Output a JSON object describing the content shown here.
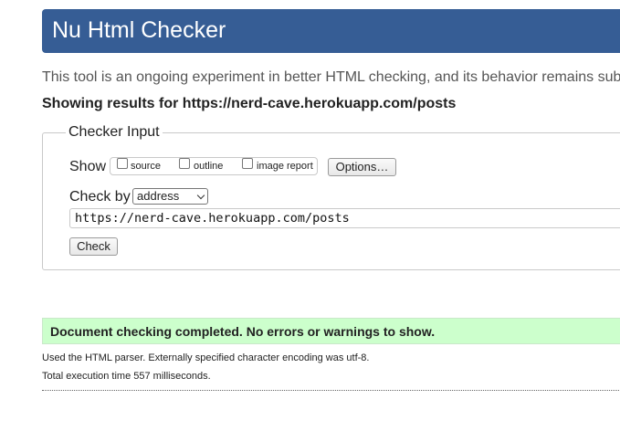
{
  "header": {
    "title": "Nu Html Checker",
    "banner_color": "#365d95"
  },
  "intro_text": "This tool is an ongoing experiment in better HTML checking, and its behavior remains sub",
  "results_heading": "Showing results for https://nerd-cave.herokuapp.com/posts",
  "checker_input": {
    "legend": "Checker Input",
    "show_label": "Show",
    "options": [
      {
        "label": "source",
        "checked": false
      },
      {
        "label": "outline",
        "checked": false
      },
      {
        "label": "image report",
        "checked": false
      }
    ],
    "options_button": "Options…",
    "check_by_label": "Check by",
    "check_by_selected": "address",
    "url_value": "https://nerd-cave.herokuapp.com/posts",
    "check_button": "Check"
  },
  "result": {
    "message": "Document checking completed. No errors or warnings to show.",
    "message_bg": "#ccffcc",
    "parser_info": "Used the HTML parser. Externally specified character encoding was utf-8.",
    "execution_time": "Total execution time 557 milliseconds."
  }
}
